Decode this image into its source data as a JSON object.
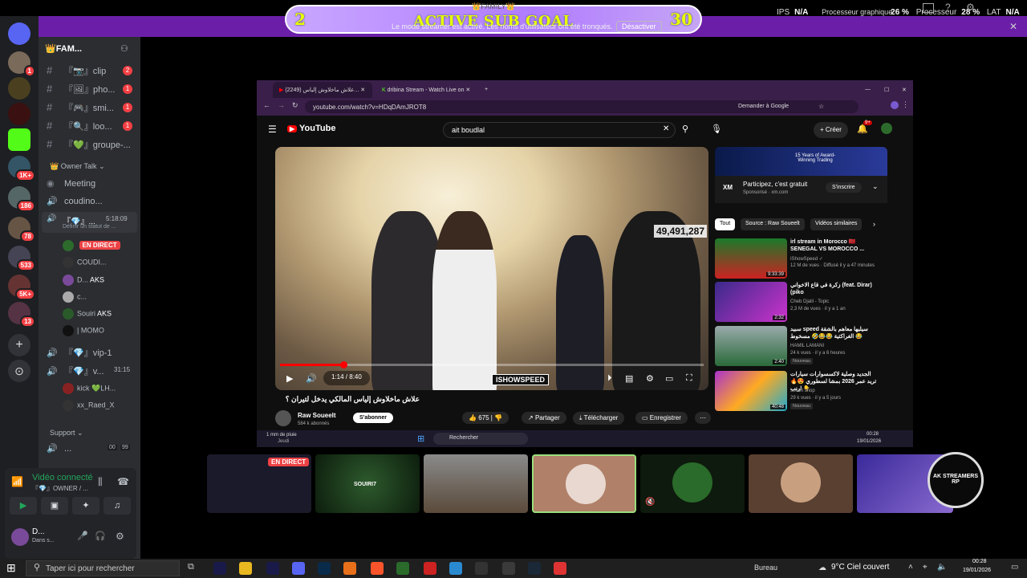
{
  "overlay": {
    "sub_goal_title": "ACTIVE SUB GOAL",
    "sub_goal_family": "👑FAMILY👑",
    "sub_goal_current": "2",
    "sub_goal_target": "30",
    "streamer_message": "Le mode streamer est activé. Les noms d'utilisateur ont été tronqués.",
    "deactivate_label": "Désactiver",
    "stats": {
      "ips_label": "IPS",
      "ips_value": "N/A",
      "gpu_label": "Processeur graphique",
      "gpu_value": "26 %",
      "cpu_label": "Processeur",
      "cpu_value": "28 %",
      "lat_label": "LAT",
      "lat_value": "N/A"
    }
  },
  "discord": {
    "rail_badges": [
      "1",
      "1K+",
      "186",
      "78",
      "533",
      "5K+",
      "13"
    ],
    "server_name": "👑FAM...",
    "channels": [
      {
        "name": "『📷』clip",
        "badge": "2"
      },
      {
        "name": "『🖼』pho...",
        "badge": "1"
      },
      {
        "name": "『🎮』smi...",
        "badge": "1"
      },
      {
        "name": "『🔍』loo...",
        "badge": "1"
      },
      {
        "name": "『💚』groupe-...",
        "badge": ""
      }
    ],
    "category_owner": "👑 Owner Talk",
    "meeting": "Meeting",
    "voice_coudino": "coudino...",
    "voice_active": "『💎』...",
    "voice_active_time": "5:18:09",
    "status_hint": "Définir un statut de ...",
    "users": [
      {
        "name": "",
        "tag": "EN DIRECT"
      },
      {
        "name": "COUDI...",
        "tag": ""
      },
      {
        "name": "D...",
        "tag": "AKS"
      },
      {
        "name": "c...",
        "tag": ""
      },
      {
        "name": "Souiri",
        "tag": "AKS"
      },
      {
        "name": "| MOMO",
        "tag": ""
      }
    ],
    "vip1": "『💎』vip-1",
    "voice_v": "『💎』v...",
    "voice_v_time": "31:15",
    "vip_users": [
      "kick 💚LH...",
      "xx_Raed_X"
    ],
    "support": "Support",
    "support_count_a": "00",
    "support_count_b": "99",
    "voice_panel": {
      "title": "Vidéo connecté",
      "subtitle": "『💎』OWNER / ..."
    },
    "self_user": "D...",
    "self_status": "Dans s..."
  },
  "browser": {
    "tabs": [
      {
        "label": "(2249) علاش ماخلاوش إلياس..."
      },
      {
        "label": "dribina Stream - Watch Live on"
      }
    ],
    "url": "youtube.com/watch?v=HDqDAmJROT8",
    "ask_google": "Demander à Google",
    "search_query": "ait boudlal",
    "create_label": "Créer",
    "notif_count": "9+",
    "video": {
      "time": "1:14 / 8:40",
      "view_overlay": "49,491,287",
      "watermark": "ISHOWSPEED",
      "progress_fraction": 0.15,
      "title": "علاش ماخلاوش إلياس المالكي يدخل لتيران ؟",
      "channel": "Raw Soueelt",
      "subscribers": "584 k abonnés",
      "subscribe_label": "S'abonner",
      "likes": "675",
      "share": "Partager",
      "download": "Télécharger",
      "save": "Enregistrer"
    },
    "ad": {
      "banner_text": "15 Years of Award-Winning Trading",
      "title": "Participez, c'est gratuit",
      "sponsor": "Sponsorisé · xm.com",
      "cta": "S'inscrire"
    },
    "chips": [
      "Tout",
      "Source : Raw Soueelt",
      "Vidéos similaires"
    ],
    "recommendations": [
      {
        "title": "irl stream in Morocco 🇲🇦 SENEGAL VS MOROCCO ...",
        "channel": "IShowSpeed ✓",
        "meta": "12 M de vues · Diffusé il y a 47 minutes",
        "duration": "9:33:39",
        "new": ""
      },
      {
        "title": "زكرة في قاع الاخواني (feat. Dirar) (piko",
        "channel": "Cheb Djalil - Topic",
        "meta": "2,3 M de vues · il y a 1 an",
        "duration": "2:32",
        "new": ""
      },
      {
        "title": "سبيد speed سيليها معاهم بالشقة الغراكتية 😂😂🤣 مسخوط 😂",
        "channel": "HAMIL LAMANI",
        "meta": "24 k vues · il y a 6 heures",
        "duration": "2:40",
        "new": "Nouveau"
      },
      {
        "title": "الجديد وصلية لاكسسوارات سيارات تريد عمر 2026 بمشا لسطوري 😍🔥 👇 ارنب",
        "channel": "sekori shop",
        "meta": "29 k vues · il y a 5 jours",
        "duration": "40:48",
        "new": "Nouveau"
      }
    ],
    "taskbar_weather": "1 mm de pluie",
    "taskbar_weather_day": "Jeudi",
    "taskbar_search": "Rechercher",
    "taskbar_time": "00:28",
    "taskbar_date": "19/01/2026"
  },
  "cams": {
    "live_label": "EN DIRECT",
    "names": [
      "SOUIRI7",
      "",
      "",
      "",
      "",
      "AK STREAMERS RP"
    ]
  },
  "taskbar": {
    "search_placeholder": "Taper ici pour rechercher",
    "desktop_label": "Bureau",
    "weather": "9°C  Ciel couvert",
    "time": "00:28",
    "date": "19/01/2026"
  }
}
